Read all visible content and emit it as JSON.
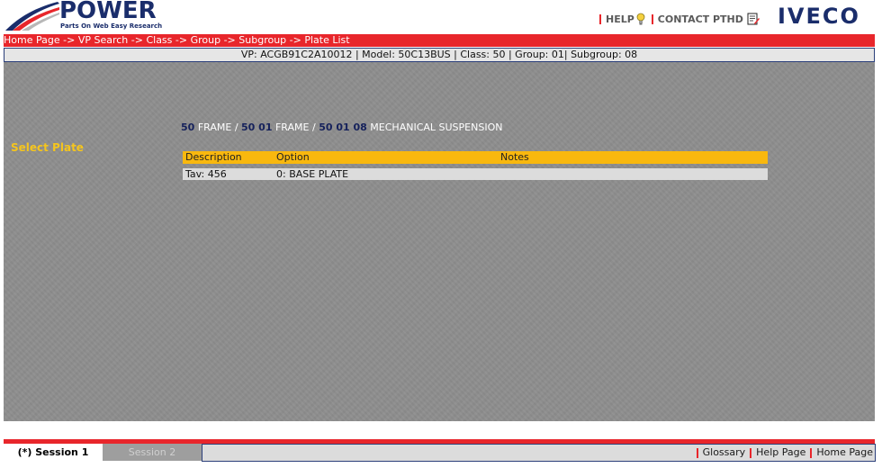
{
  "logo": {
    "title": "POWER",
    "subtitle": "Parts On Web Easy Research"
  },
  "header": {
    "help_label": "HELP",
    "contact_label": "CONTACT PTHD",
    "brand": "IVECO"
  },
  "breadcrumb": {
    "items": [
      "Home Page",
      "VP Search",
      "Class",
      "Group",
      "Subgroup",
      "Plate List"
    ],
    "separator": " -> "
  },
  "info": {
    "text": "VP: ACGB91C2A10012 | Model: 50C13BUS | Class: 50 | Group: 01| Subgroup: 08"
  },
  "main": {
    "section_label": "Select Plate",
    "trail": {
      "class_code": "50",
      "class_name": "FRAME",
      "group_code": "50 01",
      "group_name": "FRAME",
      "subgroup_code": "50 01 08",
      "subgroup_name": "MECHANICAL SUSPENSION",
      "sep": "/"
    },
    "table": {
      "headers": [
        "Description",
        "Option",
        "Notes"
      ],
      "rows": [
        {
          "description": "Tav: 456",
          "option": "0:   BASE PLATE",
          "notes": ""
        }
      ]
    }
  },
  "footer": {
    "sessions": [
      "(*) Session 1",
      "Session 2"
    ],
    "links": [
      "Glossary",
      "Help Page",
      "Home Page"
    ]
  },
  "colors": {
    "brand_red": "#e8262b",
    "brand_navy": "#1a2d6b",
    "table_header": "#f9b80e",
    "label_yellow": "#f5c51d",
    "content_grey": "#8e8e8e"
  }
}
